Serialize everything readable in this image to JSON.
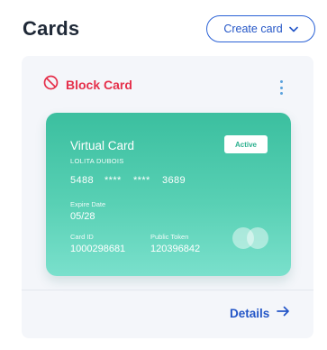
{
  "header": {
    "title": "Cards",
    "create_button_label": "Create card"
  },
  "panel": {
    "block_label": "Block Card",
    "details_label": "Details"
  },
  "card": {
    "title": "Virtual Card",
    "holder": "LOLITA DUBOIS",
    "status": "Active",
    "number_groups": [
      "5488",
      "****",
      "****",
      "3689"
    ],
    "expire_label": "Expire Date",
    "expire_value": "05/28",
    "card_id_label": "Card ID",
    "card_id_value": "1000298681",
    "token_label": "Public Token",
    "token_value": "120396842"
  },
  "colors": {
    "accent_blue": "#2456c7",
    "danger_red": "#e5304b",
    "card_green": "#3bbf9f"
  },
  "icons": [
    "chevron-down-icon",
    "block-icon",
    "more-vertical-icon",
    "card-network-logo",
    "arrow-right-icon"
  ]
}
